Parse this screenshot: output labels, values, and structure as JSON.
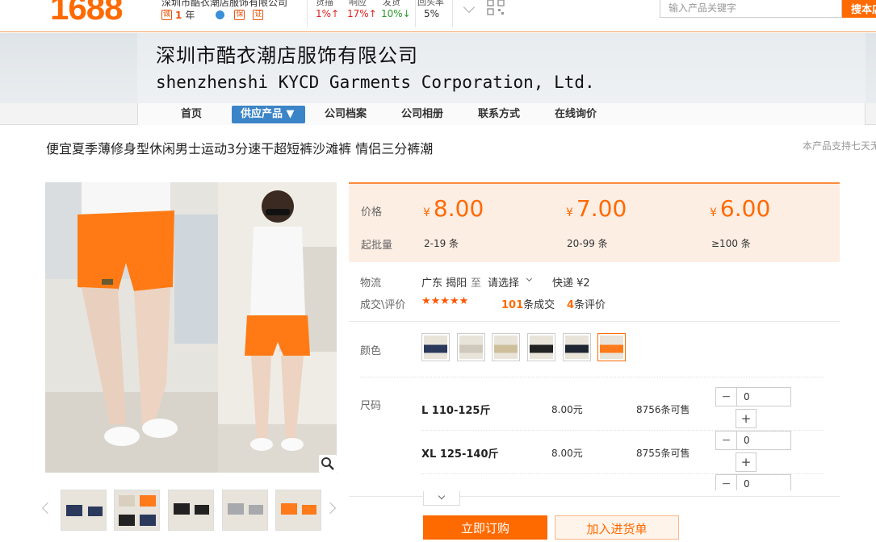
{
  "header": {
    "logo": "1688",
    "shop_name": "深圳市酷衣潮店服饰有限公司",
    "years_value": "1",
    "years_unit": "年",
    "stats": [
      {
        "label": "货描",
        "value": "1%↑",
        "trend": "up"
      },
      {
        "label": "响应",
        "value": "17%↑",
        "trend": "up"
      },
      {
        "label": "发货",
        "value": "10%↓",
        "trend": "down"
      },
      {
        "label": "回头率",
        "value": "5%",
        "trend": "none"
      }
    ],
    "search_placeholder": "输入产品关键字",
    "search_button": "搜本店"
  },
  "banner": {
    "company_cn": "深圳市酷衣潮店服饰有限公司",
    "company_en": "shenzhenshi KYCD Garments Corporation, Ltd."
  },
  "nav": {
    "items": [
      "首页",
      "供应产品 ▼",
      "公司档案",
      "公司相册",
      "联系方式",
      "在线询价"
    ],
    "active_index": 1
  },
  "product": {
    "title": "便宜夏季薄修身型休闲男士运动3分速干超短裤沙滩裤 情侣三分裤潮",
    "support_note": "本产品支持七天无理由退货"
  },
  "pricing": {
    "price_label": "价格",
    "qty_label": "起批量",
    "currency": "¥",
    "tiers": [
      {
        "price": "8.00",
        "qty": "2-19 条"
      },
      {
        "price": "7.00",
        "qty": "20-99 条"
      },
      {
        "price": "6.00",
        "qty": "≥100 条"
      }
    ]
  },
  "logistics": {
    "label": "物流",
    "from": "广东 揭阳",
    "to_word": "至",
    "destination": "请选择",
    "shipping": "快递 ¥2"
  },
  "reviews": {
    "label": "成交\\评价",
    "stars": "★★★★★",
    "deals_count": "101",
    "deals_text": "条成交",
    "review_count": "4",
    "review_text": "条评价"
  },
  "colors": {
    "label": "颜色",
    "swatches": [
      "#2b3a5c",
      "#cfc9bc",
      "#222222",
      "#1f2633",
      "#a7a9ad",
      "#ff7a1a"
    ],
    "selected_index": 5
  },
  "sizes": {
    "label": "尺码",
    "rows": [
      {
        "name": "L 110-125斤",
        "price": "8.00元",
        "stock": "8756条可售",
        "qty": "0"
      },
      {
        "name": "XL 125-140斤",
        "price": "8.00元",
        "stock": "8755条可售",
        "qty": "0"
      },
      {
        "name": "",
        "price": "",
        "stock": "",
        "qty": "0"
      }
    ]
  },
  "actions": {
    "order": "立即订购",
    "cart": "加入进货单"
  },
  "accent": "#ff6a00"
}
